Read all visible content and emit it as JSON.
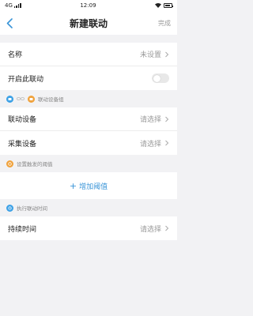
{
  "status_bar": {
    "network": "4G",
    "time": "12:09"
  },
  "nav": {
    "title": "新建联动",
    "done_label": "完成"
  },
  "rows": {
    "name": {
      "label": "名称",
      "value": "未设置"
    },
    "enable": {
      "label": "开启此联动",
      "on": false
    }
  },
  "section_devices": {
    "title": "联动设备组"
  },
  "devices": [
    {
      "label": "联动设备",
      "value": "请选择"
    },
    {
      "label": "采集设备",
      "value": "请选择"
    }
  ],
  "section_threshold": {
    "title": "设置触发的阈值"
  },
  "add_threshold": {
    "label": "增加阈值"
  },
  "section_time": {
    "title": "执行联动时间"
  },
  "duration": {
    "label": "持续时间",
    "value": "请选择"
  },
  "colors": {
    "accent": "#3a95d8",
    "orange": "#f0a23c",
    "blue_icon": "#3ca1e6",
    "background": "#f2f2f4"
  }
}
